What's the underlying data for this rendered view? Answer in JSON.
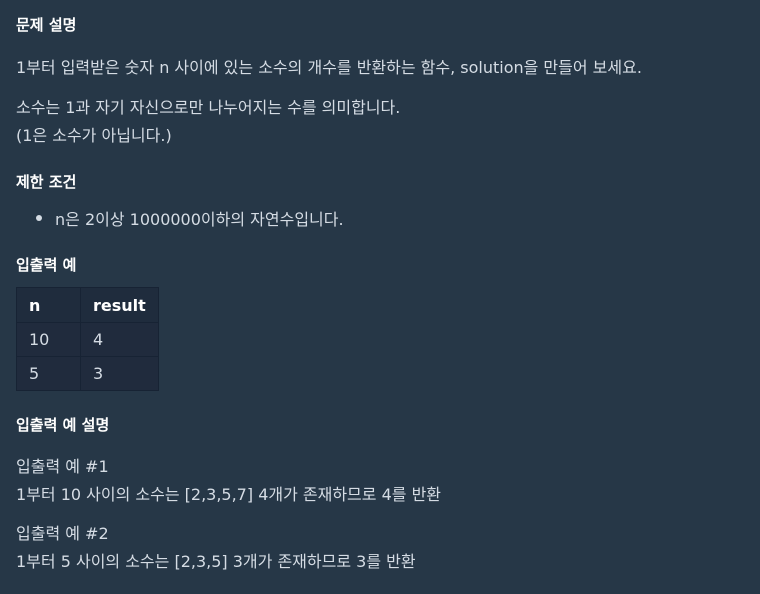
{
  "heading_description": "문제 설명",
  "desc_line1": "1부터 입력받은 숫자 n 사이에 있는 소수의 개수를 반환하는 함수, solution을 만들어 보세요.",
  "desc_line2": "소수는 1과 자기 자신으로만 나누어지는 수를 의미합니다.",
  "desc_line3": "(1은 소수가 아닙니다.)",
  "heading_constraints": "제한 조건",
  "constraints": [
    "n은 2이상 1000000이하의 자연수입니다."
  ],
  "heading_examples": "입출력 예",
  "table": {
    "headers": [
      "n",
      "result"
    ],
    "rows": [
      [
        "10",
        "4"
      ],
      [
        "5",
        "3"
      ]
    ]
  },
  "heading_example_explanation": "입출력 예 설명",
  "example1_title": "입출력 예 #1",
  "example1_text": "1부터 10 사이의 소수는 [2,3,5,7] 4개가 존재하므로 4를 반환",
  "example2_title": "입출력 예 #2",
  "example2_text": "1부터 5 사이의 소수는 [2,3,5] 3개가 존재하므로 3를 반환"
}
